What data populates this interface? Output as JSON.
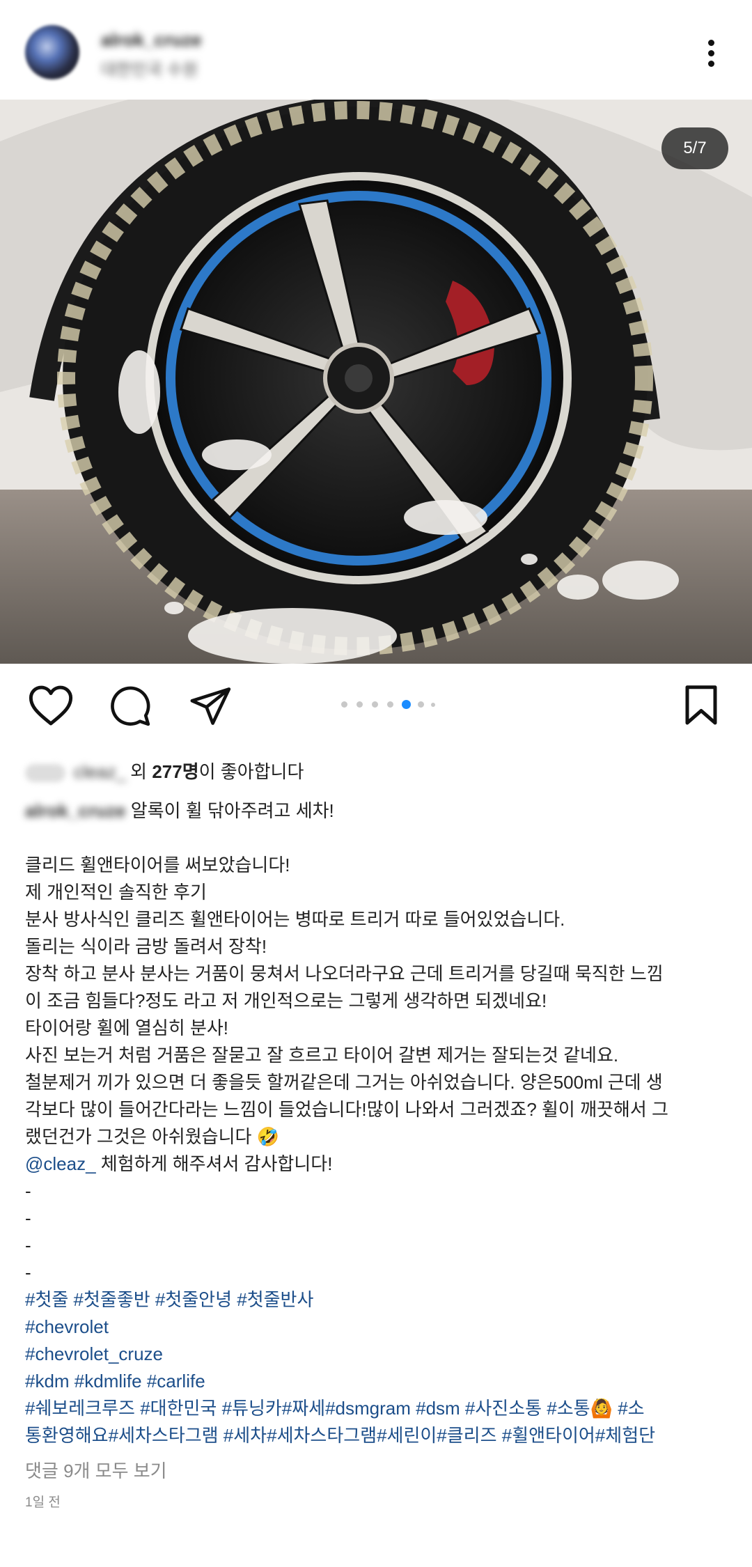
{
  "post": {
    "username": "alrok_cruze",
    "location": "대한민국 수원",
    "image_counter": "5/7",
    "likes_prefix": "cleaz_",
    "likes_mid": "외 ",
    "likes_count": "277명",
    "likes_suffix": "이 좋아합니다",
    "caption_user": "alrok_cruze",
    "caption_first": " 알록이 휠 닦아주려고 세차!",
    "lines": [
      "클리드 휠앤타이어를 써보았습니다!",
      "제 개인적인 솔직한 후기",
      "분사 방사식인 클리즈 휠앤타이어는 병따로 트리거 따로 들어있었습니다.",
      "돌리는 식이라 금방 돌려서 장착!",
      "장착 하고 분사 분사는 거품이 뭉쳐서 나오더라구요 근데 트리거를 당길때 묵직한 느낌",
      "이 조금 힘들다?정도 라고 저 개인적으로는 그렇게 생각하면 되겠네요!",
      "타이어랑 휠에 열심히 분사!",
      "사진 보는거 처럼 거품은 잘묻고 잘 흐르고 타이어 갈변 제거는 잘되는것 같네요.",
      "철분제거 끼가 있으면 더 좋을듯 할꺼같은데 그거는 아쉬었습니다.  양은500ml 근데 생",
      "각보다 많이 들어간다라는 느낌이 들었습니다!많이 나와서 그러겠죠? 휠이 깨끗해서 그",
      "랬던건가 그것은 아쉬웠습니다 🤣"
    ],
    "mention": "@cleaz_",
    "mention_rest": "  체험하게 해주셔서 감사합니다!",
    "dashes": [
      "-",
      "-",
      "-",
      "-"
    ],
    "hashtag_lines": [
      "#첫줄 #첫줄좋반 #첫줄안녕 #첫줄반사",
      "#chevrolet",
      "#chevrolet_cruze",
      "#kdm #kdmlife #carlife",
      "#쉐보레크루즈 #대한민국 #튜닝카#짜세#dsmgram #dsm #사진소통 #소통🙆 #소",
      "통환영해요#세차스타그램 #세차#세차스타그램#세린이#클리즈 #휠앤타이어#체험단"
    ],
    "comments_link": "댓글 9개 모두 보기",
    "timestamp": "1일 전"
  },
  "icons": {
    "more": "more-vertical-icon",
    "like": "heart-icon",
    "comment": "comment-icon",
    "share": "send-icon",
    "save": "bookmark-icon"
  },
  "carousel": {
    "total": 7,
    "active": 5
  },
  "colors": {
    "link": "#1c4e8a",
    "active_dot": "#1a8cff"
  }
}
